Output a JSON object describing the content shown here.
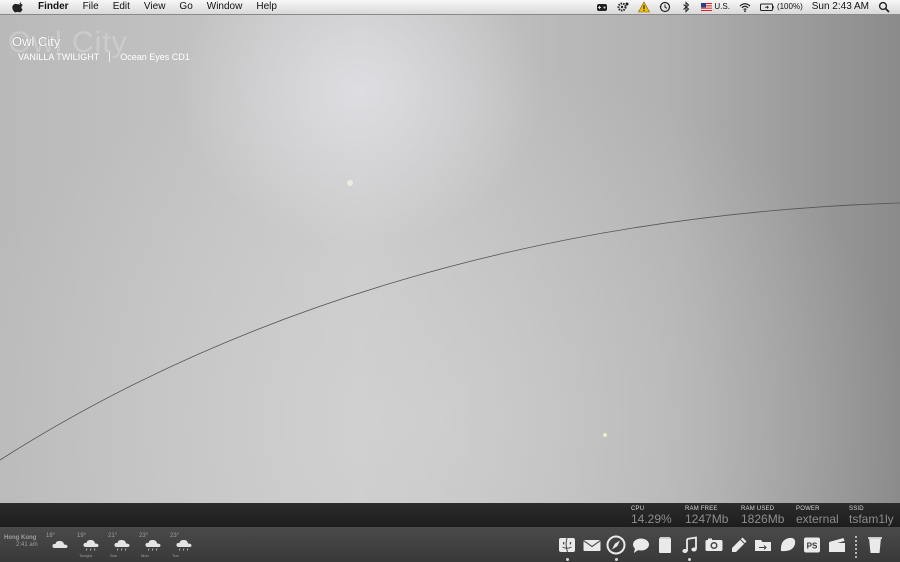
{
  "menubar": {
    "app_name": "Finder",
    "menus": [
      "File",
      "Edit",
      "View",
      "Go",
      "Window",
      "Help"
    ],
    "input_source": "U.S.",
    "battery_percent": "(100%)",
    "clock": "Sun 2:43 AM"
  },
  "now_playing": {
    "artist": "Owl City",
    "ghost_text": "Owl City",
    "track": "VANILLA TWILIGHT",
    "album": "Ocean Eyes CD1"
  },
  "system_stats": [
    {
      "label": "CPU",
      "value": "14.29%"
    },
    {
      "label": "RAM FREE",
      "value": "1247Mb"
    },
    {
      "label": "RAM USED",
      "value": "1826Mb"
    },
    {
      "label": "POWER",
      "value": "external"
    },
    {
      "label": "SSID",
      "value": "tsfam1ly"
    }
  ],
  "weather": {
    "city": "Hong Kong",
    "time": "2:41 am",
    "forecast": [
      {
        "temp": "18°",
        "day": "",
        "icon": "cloud-icon"
      },
      {
        "temp": "19°",
        "day": "Tonight",
        "icon": "rain-cloud-icon"
      },
      {
        "temp": "21°",
        "day": "Sun",
        "icon": "rain-cloud-icon"
      },
      {
        "temp": "23°",
        "day": "Mon",
        "icon": "rain-cloud-icon"
      },
      {
        "temp": "23°",
        "day": "Tue",
        "icon": "rain-cloud-icon"
      }
    ]
  },
  "dock": {
    "items": [
      {
        "name": "finder-icon",
        "running": true
      },
      {
        "name": "mail-icon",
        "running": false
      },
      {
        "name": "safari-compass-icon",
        "running": true
      },
      {
        "name": "ichat-bubble-icon",
        "running": false
      },
      {
        "name": "notes-icon",
        "running": false
      },
      {
        "name": "itunes-music-icon",
        "running": true
      },
      {
        "name": "photo-icon",
        "running": false
      },
      {
        "name": "pencil-icon",
        "running": false
      },
      {
        "name": "folder-icon",
        "running": false
      },
      {
        "name": "leaf-icon",
        "running": false
      },
      {
        "name": "photoshop-icon",
        "running": false
      },
      {
        "name": "clapper-icon",
        "running": false
      },
      {
        "name": "separator-icon",
        "running": false
      },
      {
        "name": "trash-icon",
        "running": false
      }
    ],
    "photoshop_label": "PS"
  },
  "colors": {
    "menubar_bg": "#e6e6e6",
    "stats_bg": "#232323",
    "dock_bg": "#414141",
    "stat_value": "#8d8d8d"
  }
}
